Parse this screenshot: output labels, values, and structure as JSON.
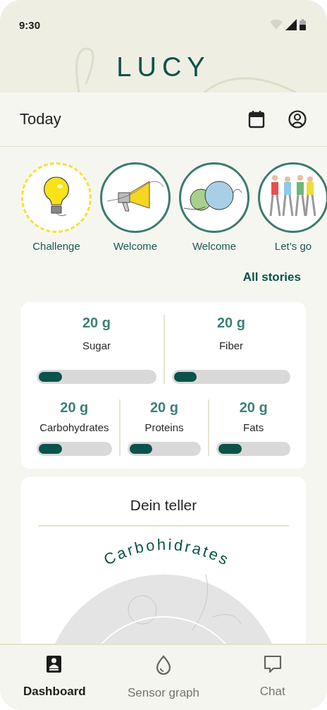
{
  "status_bar": {
    "time": "9:30"
  },
  "app_title": "LUCY",
  "top_bar": {
    "title": "Today"
  },
  "stories": [
    {
      "label": "Challenge",
      "kind": "challenge"
    },
    {
      "label": "Welcome",
      "kind": "story"
    },
    {
      "label": "Welcome",
      "kind": "story"
    },
    {
      "label": "Let’s go",
      "kind": "story"
    }
  ],
  "all_stories_link": "All stories",
  "nutrients": [
    [
      {
        "value": "20 g",
        "label": "Sugar",
        "level": 0.2
      },
      {
        "value": "20 g",
        "label": "Fiber",
        "level": 0.2
      }
    ],
    [
      {
        "value": "20 g",
        "label": "Carbohydrates",
        "level": 0.33
      },
      {
        "value": "20 g",
        "label": "Proteins",
        "level": 0.33
      },
      {
        "value": "20 g",
        "label": "Fats",
        "level": 0.33
      }
    ]
  ],
  "plate_card": {
    "title": "Dein teller",
    "arc_label": "Carbohidrates"
  },
  "bottom_nav": [
    {
      "label": "Dashboard",
      "kind": "dashboard",
      "selected": true
    },
    {
      "label": "Sensor graph",
      "kind": "sensor",
      "selected": false
    },
    {
      "label": "Chat",
      "kind": "chat",
      "selected": false
    }
  ]
}
